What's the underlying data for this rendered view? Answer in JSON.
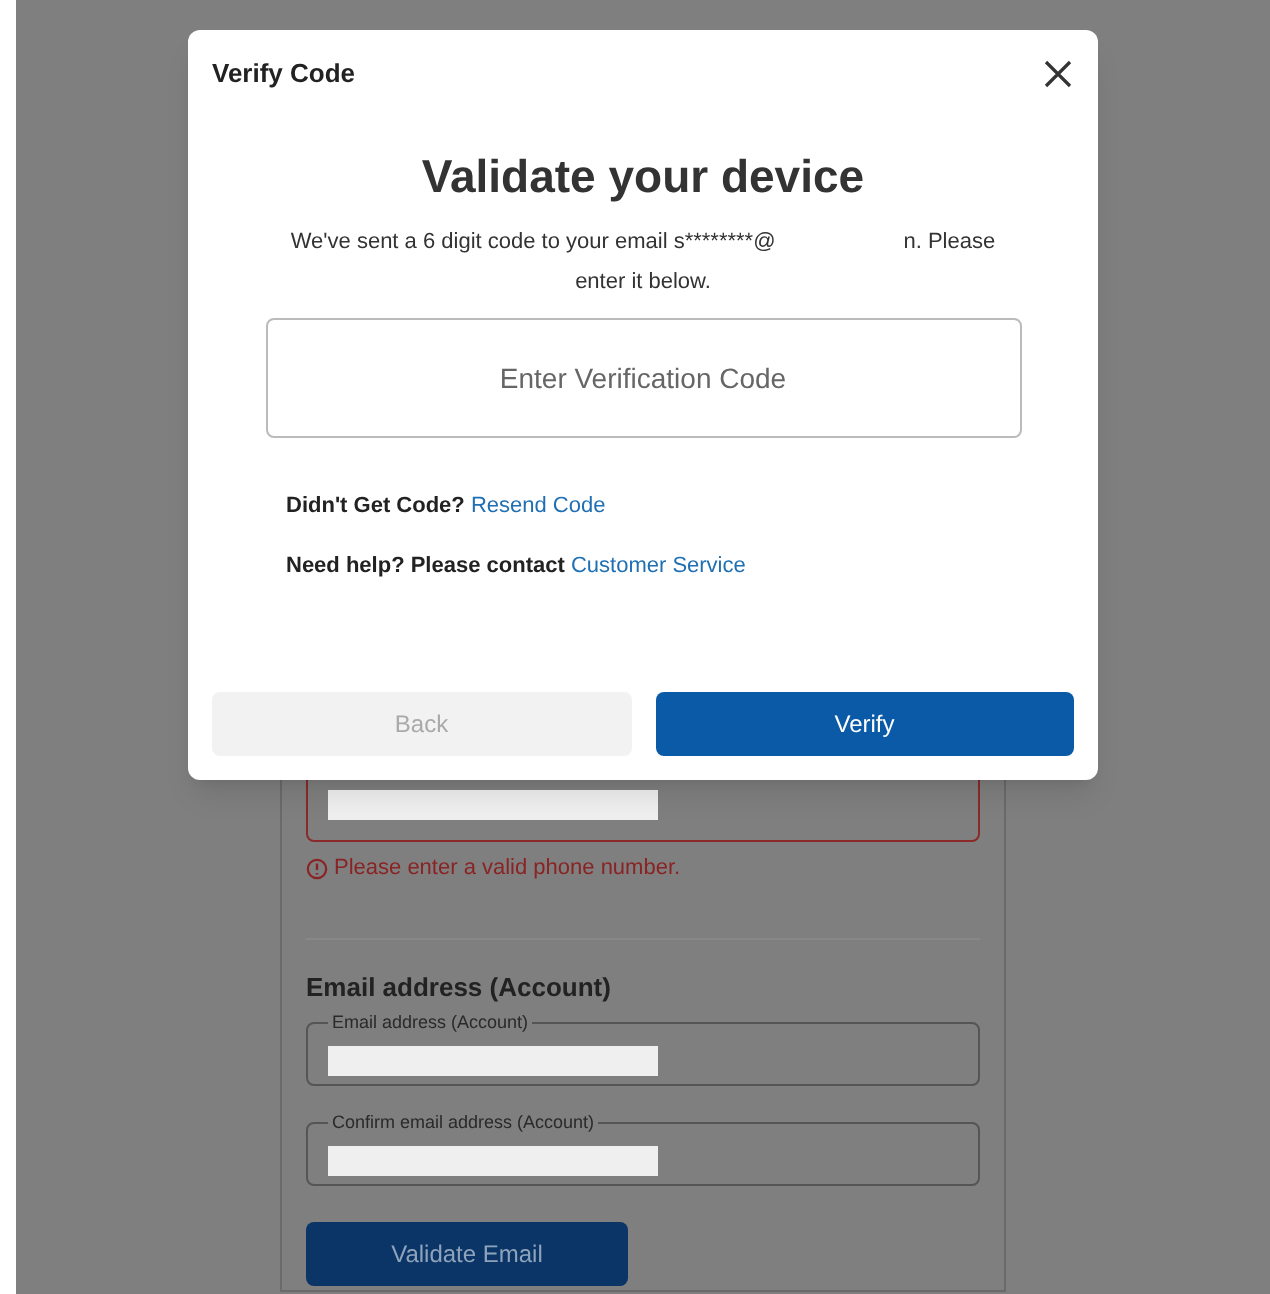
{
  "background_form": {
    "phone_error": "Please enter a valid phone number.",
    "email_section_title": "Email address (Account)",
    "fields": [
      {
        "label": "Email address (Account)"
      },
      {
        "label": "Confirm email address (Account)"
      }
    ],
    "validate_button": "Validate Email"
  },
  "dialog": {
    "title": "Verify Code",
    "heading": "Validate your device",
    "message_start": "We've sent a 6 digit code to your email s********@",
    "message_end": "n. Please enter it below.",
    "code_field": {
      "placeholder": "Enter Verification Code"
    },
    "help_lines": [
      {
        "text": "Didn't Get Code?",
        "link": "Resend Code"
      },
      {
        "text": "Need help? Please contact",
        "link": "Customer Service"
      }
    ],
    "buttons": [
      {
        "label": "Back",
        "disabled": true
      },
      {
        "label": "Verify",
        "disabled": false
      }
    ]
  }
}
